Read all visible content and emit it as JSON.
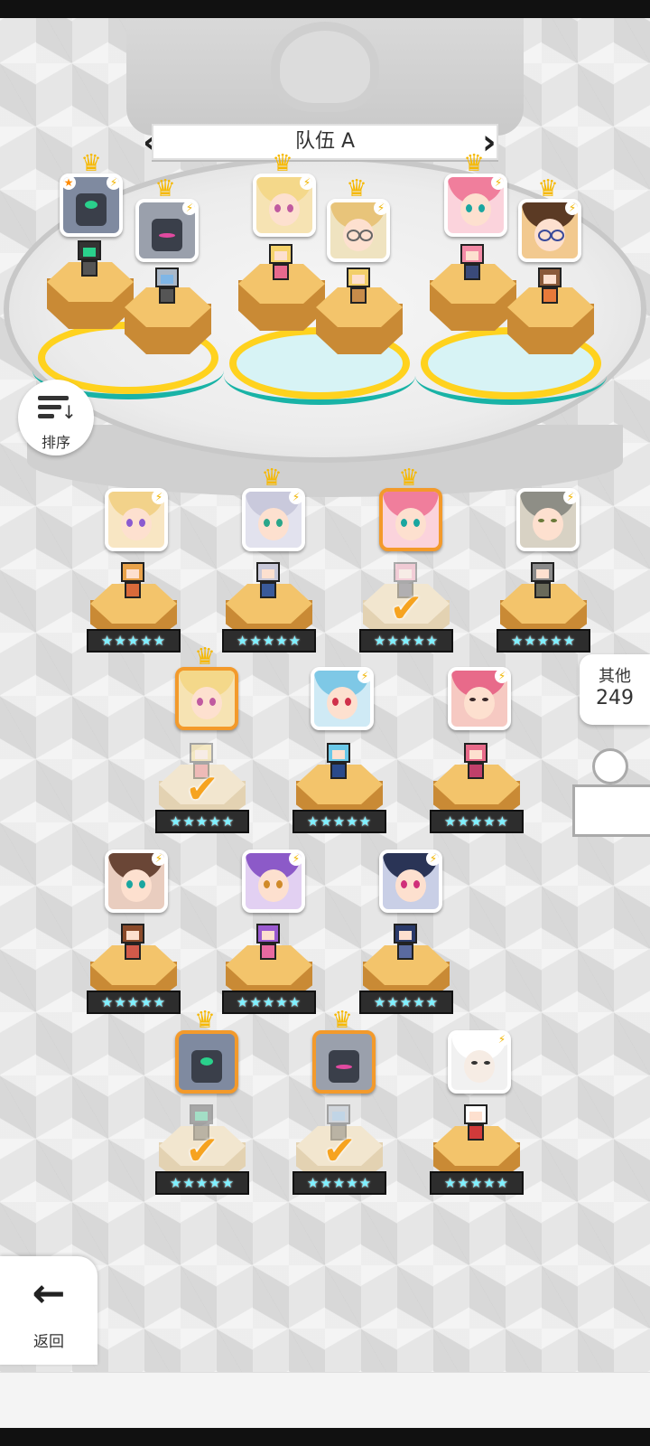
{
  "team": {
    "title": "队伍 A",
    "prev_icon": "chevron-left-icon",
    "next_icon": "chevron-right-icon"
  },
  "sort": {
    "label": "排序",
    "icon": "sort-descending-icon"
  },
  "others": {
    "label": "其他",
    "count": "249"
  },
  "back": {
    "label": "返回",
    "icon": "arrow-left-icon"
  },
  "colors": {
    "selected_border": "#f39a2b",
    "pad_ring": "#ffd21e",
    "pad_teal": "#19b3a6",
    "platform_top": "#f3c46b",
    "check": "#f6a320"
  },
  "team_slots": [
    {
      "name": "robot-green-visor",
      "crown": true,
      "leader_star": true,
      "bolt": true
    },
    {
      "name": "robot-grey-pink",
      "crown": true,
      "bolt": true
    },
    {
      "name": "blonde-green-streak",
      "crown": true,
      "bolt": true
    },
    {
      "name": "blonde-glasses-bunny",
      "crown": true,
      "bolt": true
    },
    {
      "name": "pink-hair-cap",
      "crown": true,
      "bolt": true
    },
    {
      "name": "brown-hair-glasses",
      "crown": true,
      "bolt": true
    }
  ],
  "roster": [
    {
      "name": "blonde-hair-violet-eyes",
      "stars": 5,
      "crown": false,
      "selected": false
    },
    {
      "name": "silver-hair",
      "stars": 5,
      "crown": true,
      "selected": false
    },
    {
      "name": "pink-hair-cap",
      "stars": 5,
      "crown": true,
      "selected": true
    },
    {
      "name": "grey-hair-man",
      "stars": 5,
      "crown": false,
      "selected": false
    },
    {
      "name": "blonde-green-streak",
      "stars": 5,
      "crown": true,
      "selected": true
    },
    {
      "name": "blue-hair",
      "stars": 5,
      "crown": false,
      "selected": false
    },
    {
      "name": "pink-hair-bandana",
      "stars": 5,
      "crown": false,
      "selected": false
    },
    {
      "name": "pink-hair-hat",
      "stars": 5,
      "crown": false,
      "selected": false
    },
    {
      "name": "purple-hair",
      "stars": 5,
      "crown": false,
      "selected": false
    },
    {
      "name": "dark-blue-hair",
      "stars": 5,
      "crown": false,
      "selected": false
    },
    {
      "name": "robot-green-visor",
      "stars": 5,
      "crown": true,
      "selected": true
    },
    {
      "name": "robot-grey-pink",
      "stars": 5,
      "crown": true,
      "selected": true
    },
    {
      "name": "white-hair",
      "stars": 5,
      "crown": false,
      "selected": false
    }
  ]
}
